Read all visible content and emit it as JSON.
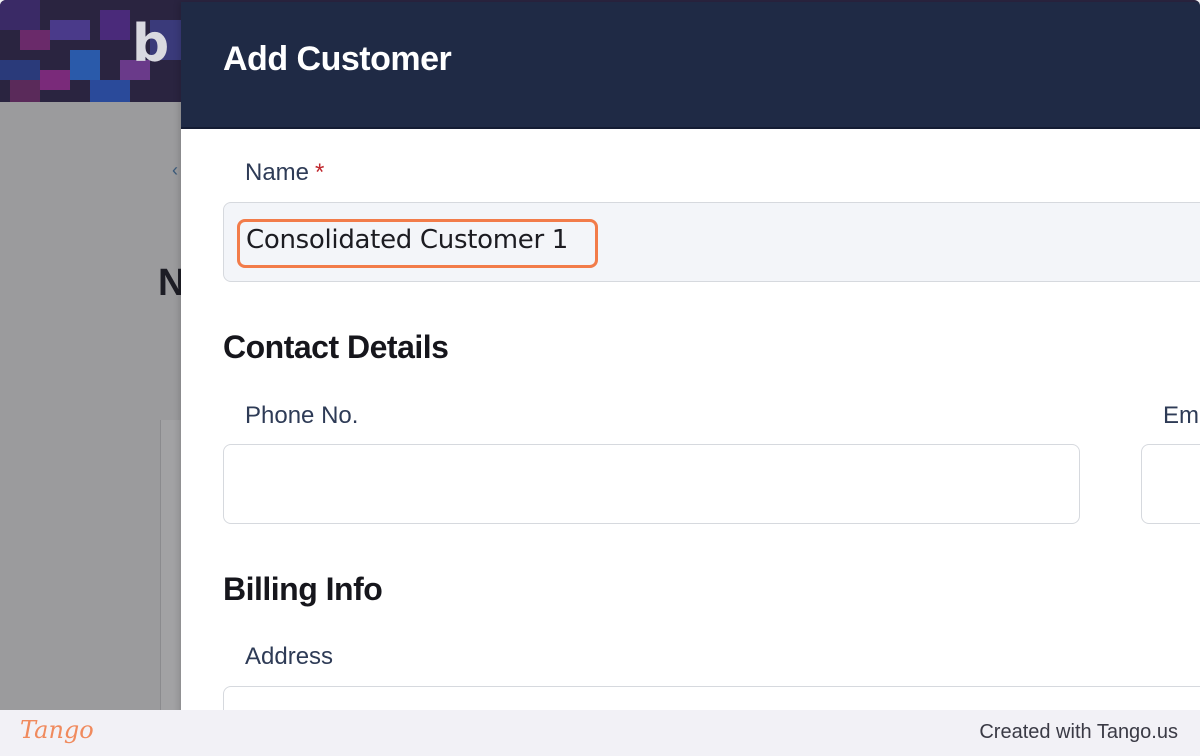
{
  "modal": {
    "title": "Add Customer",
    "name_label": "Name",
    "required_mark": "*",
    "name_value": "Consolidated Customer 1",
    "contact_section": "Contact Details",
    "phone_label": "Phone No.",
    "email_label_partial": "Em",
    "billing_section": "Billing Info",
    "address_label": "Address"
  },
  "background": {
    "logo_partial": "b",
    "heading_partial": "N",
    "back_icon": "chevron-left-icon"
  },
  "footer": {
    "logo": "Tango",
    "credit": "Created with Tango.us"
  },
  "colors": {
    "modal_header": "#1f2a45",
    "highlight": "#f27c4a",
    "required": "#c0272d",
    "tango_orange": "#f08a5d"
  }
}
